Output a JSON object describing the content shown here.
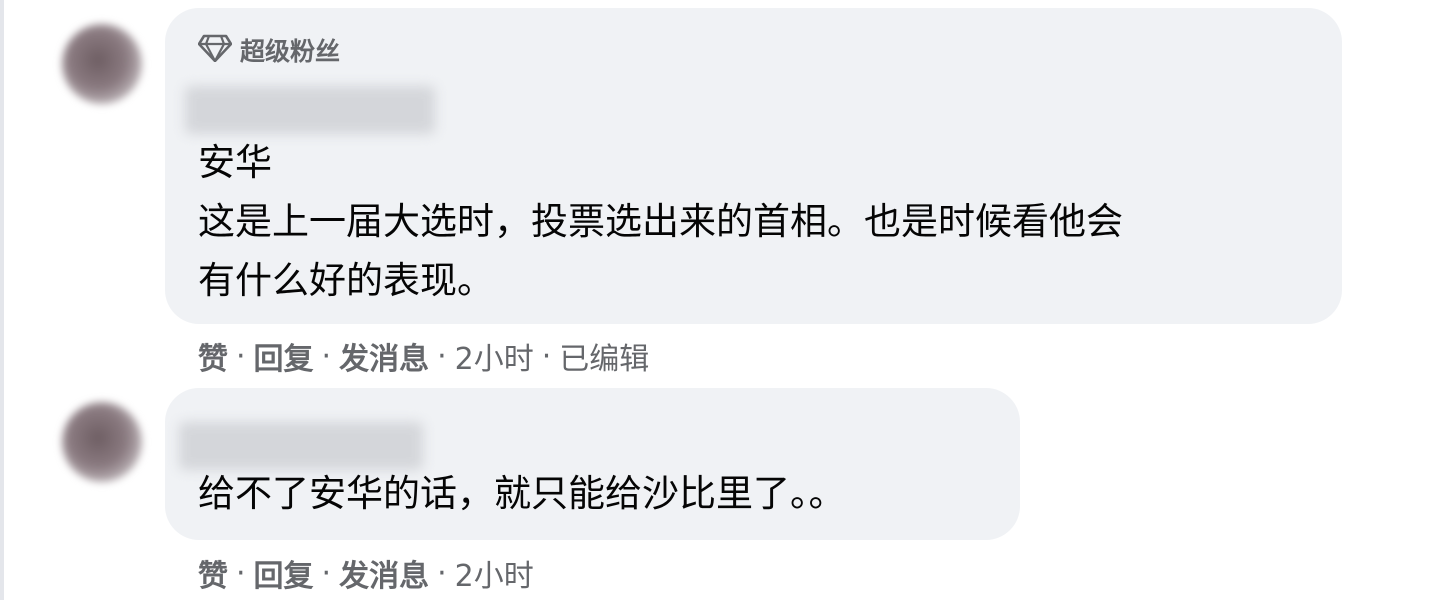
{
  "comments": [
    {
      "badge": "超级粉丝",
      "badge_icon": "diamond-icon",
      "lines": [
        "安华",
        "这是上一届大选时，投票选出来的首相。也是时候看他会",
        "有什么好的表现。"
      ],
      "actions": {
        "like": "赞",
        "reply": "回复",
        "message": "发消息",
        "time": "2小时",
        "edited": "已编辑"
      }
    },
    {
      "lines": [
        "给不了安华的话，就只能给沙比里了。。"
      ],
      "actions": {
        "like": "赞",
        "reply": "回复",
        "message": "发消息",
        "time": "2小时"
      }
    }
  ],
  "colors": {
    "bubble_bg": "#f0f2f5",
    "secondary_text": "#65676b",
    "primary_text": "#050505"
  }
}
